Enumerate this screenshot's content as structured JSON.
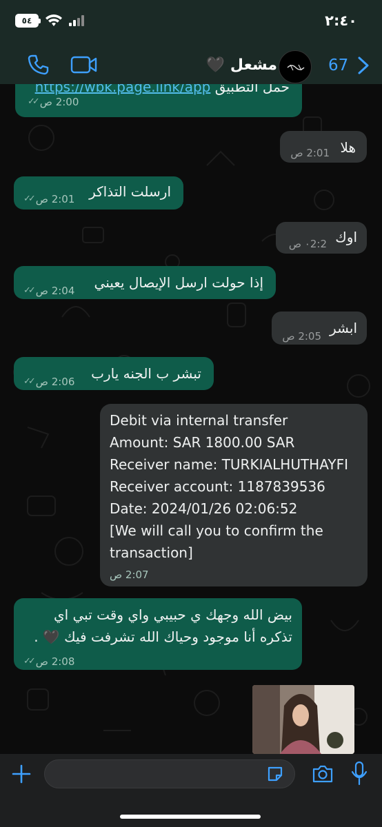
{
  "status_bar": {
    "time": "٢:٤٠",
    "battery": "٥٤"
  },
  "header": {
    "back_count": "67",
    "contact_name": "مشعل 🖤"
  },
  "messages": [
    {
      "text_link": "https://wbk.page.link/app",
      "text_before": "حمل التطبيق",
      "time": "2:00 ص"
    },
    {
      "text": "هلا",
      "time": "2:01 ص"
    },
    {
      "text": "ارسلت التذاكر",
      "time": "2:01 ص"
    },
    {
      "text": "اوك",
      "time": "٠2:2 ص"
    },
    {
      "text": "إذا حولت ارسل الإيصال يعيني",
      "time": "2:04 ص"
    },
    {
      "text": "ابشر",
      "time": "2:05 ص"
    },
    {
      "text": "تبشر ب الجنه يارب",
      "time": "2:06 ص"
    },
    {
      "lines": [
        "Debit via internal transfer",
        "Amount: SAR 1800.00 SAR",
        "Receiver name: TURKIALHUTHAYFI",
        "Receiver account: 1187839536",
        "Date: 2024/01/26 02:06:52",
        "[We will call you to confirm the transaction]"
      ],
      "time": "2:07 ص"
    },
    {
      "line1": "بيض الله وجهك ي حبيبي واي وقت تبي اي",
      "line2": "تذكره أنا موجود وحياك الله تشرفت فيك 🖤 .",
      "time": "2:08 ص"
    }
  ],
  "colors": {
    "outgoing": "#0f5c4a",
    "incoming": "#303334",
    "accent": "#3ea0ff"
  },
  "composer": {
    "placeholder": ""
  }
}
